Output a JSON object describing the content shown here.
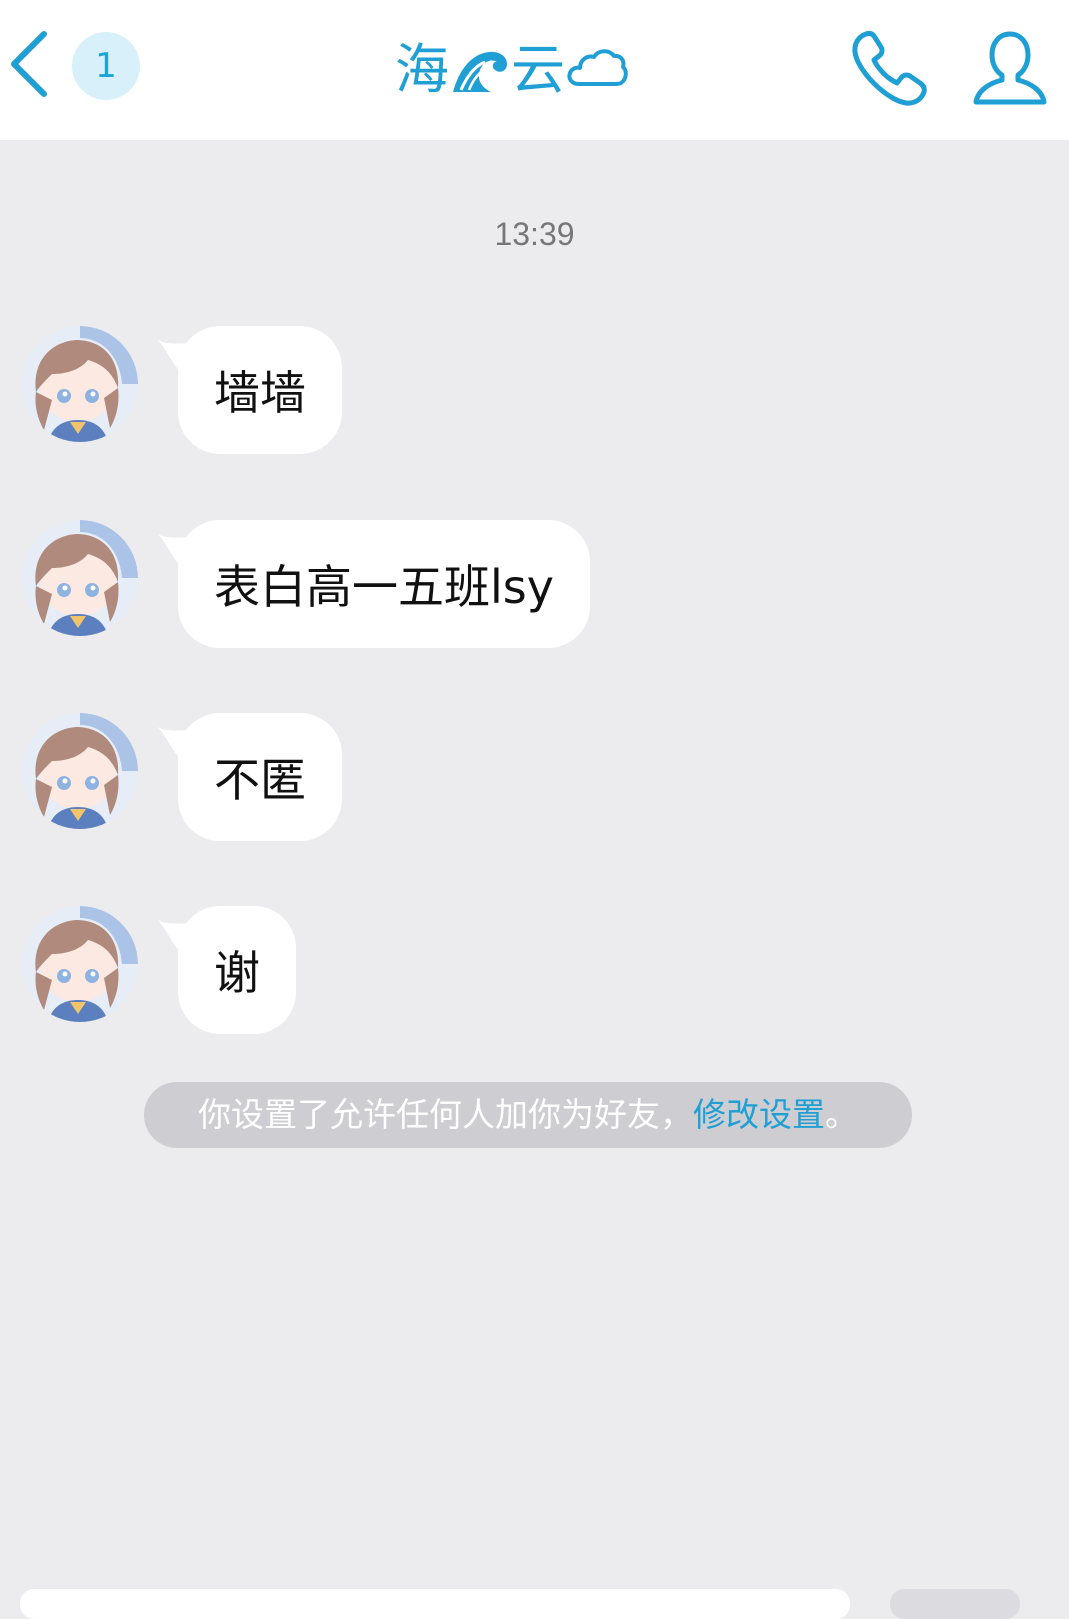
{
  "header": {
    "unread_count": "1",
    "title_char_1": "海",
    "title_char_2": "云",
    "title_icons": [
      "wave-icon",
      "cloud-icon"
    ],
    "accent_color": "#1f9fd4"
  },
  "chat": {
    "timestamp": "13:39",
    "messages": [
      {
        "text": "墙墙"
      },
      {
        "text": "表白高一五班lsy"
      },
      {
        "text": "不匿"
      },
      {
        "text": "谢"
      }
    ]
  },
  "notice": {
    "text": "你设置了允许任何人加你为好友，",
    "link": "修改设置",
    "suffix": "。"
  }
}
